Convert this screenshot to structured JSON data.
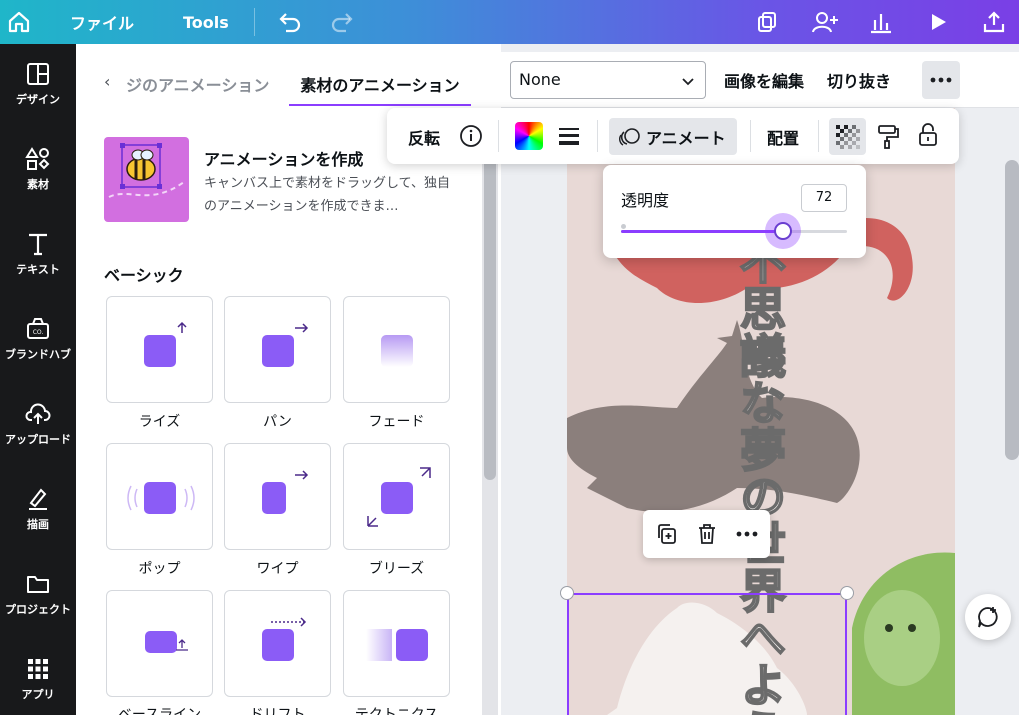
{
  "topbar": {
    "file_label": "ファイル",
    "tools_label": "Tools"
  },
  "rail": {
    "items": [
      {
        "label": "デザイン",
        "icon": "layout-icon"
      },
      {
        "label": "素材",
        "icon": "shapes-icon"
      },
      {
        "label": "テキスト",
        "icon": "text-icon"
      },
      {
        "label": "ブランドハブ",
        "icon": "brand-icon"
      },
      {
        "label": "アップロード",
        "icon": "upload-icon"
      },
      {
        "label": "描画",
        "icon": "draw-icon"
      },
      {
        "label": "プロジェクト",
        "icon": "folder-icon"
      },
      {
        "label": "アプリ",
        "icon": "apps-icon"
      }
    ]
  },
  "panel": {
    "back_label": "‹",
    "prev_tab": "ジのアニメーション",
    "active_tab": "素材のアニメーション",
    "create": {
      "title": "アニメーションを作成",
      "description": "キャンバス上で素材をドラッグして、独自のアニメーションを作成できま…"
    },
    "section_title": "ベーシック",
    "animations": [
      {
        "label": "ライズ"
      },
      {
        "label": "パン"
      },
      {
        "label": "フェード"
      },
      {
        "label": "ポップ"
      },
      {
        "label": "ワイプ"
      },
      {
        "label": "ブリーズ"
      },
      {
        "label": "ベースライン"
      },
      {
        "label": "ドリフト"
      },
      {
        "label": "テクトニクス"
      }
    ]
  },
  "context_bar": {
    "select_value": "None",
    "edit_image": "画像を編集",
    "crop": "切り抜き"
  },
  "float_toolbar": {
    "flip": "反転",
    "animate": "アニメート",
    "position": "配置"
  },
  "transparency": {
    "label": "透明度",
    "value": "72",
    "fraction": 0.72
  },
  "canvas": {
    "vertical_text": "不思議な夢の世界へようこそ"
  },
  "colors": {
    "accent": "#8b3dff",
    "rail_bg": "#18191b"
  }
}
